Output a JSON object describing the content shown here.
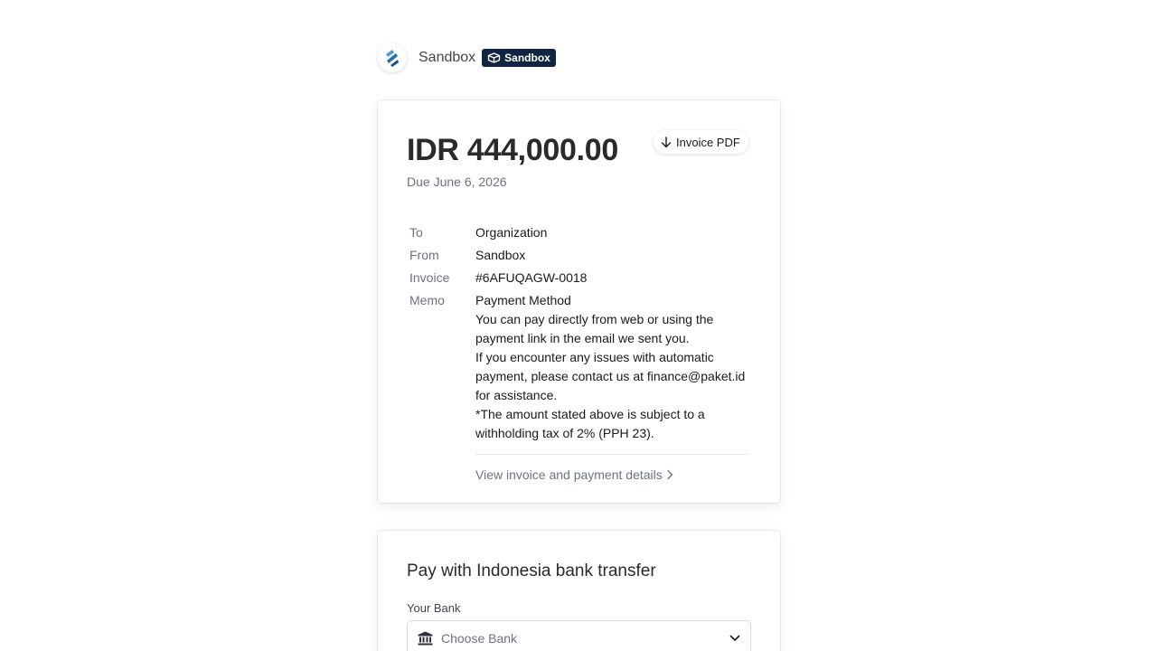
{
  "header": {
    "merchant_name": "Sandbox",
    "badge_label": "Sandbox",
    "logo_icon": "stripe-stripes-logo",
    "badge_icon": "sandbox-cube-icon"
  },
  "invoice": {
    "amount": "IDR 444,000.00",
    "pdf_button_label": "Invoice PDF",
    "due": "Due June 6, 2026",
    "fields": {
      "to_label": "To",
      "to_value": "Organization",
      "from_label": "From",
      "from_value": "Sandbox",
      "invoice_label": "Invoice",
      "invoice_value": "#6AFUQAGW-0018",
      "memo_label": "Memo",
      "memo_lines": [
        "Payment Method",
        "You can pay directly from web or using the payment link in the email we sent you.",
        "If you encounter any issues with automatic payment, please contact us at finance@paket.id for assistance.",
        "*The amount stated above is subject to a withholding tax of 2% (PPH 23)."
      ]
    },
    "view_details_label": "View invoice and payment details"
  },
  "payment": {
    "title": "Pay with Indonesia bank transfer",
    "bank_label": "Your Bank",
    "bank_placeholder": "Choose Bank"
  },
  "colors": {
    "badge_bg": "#0f2541",
    "muted_text": "#6a7383",
    "logo_blue": "#1f6fb5"
  }
}
